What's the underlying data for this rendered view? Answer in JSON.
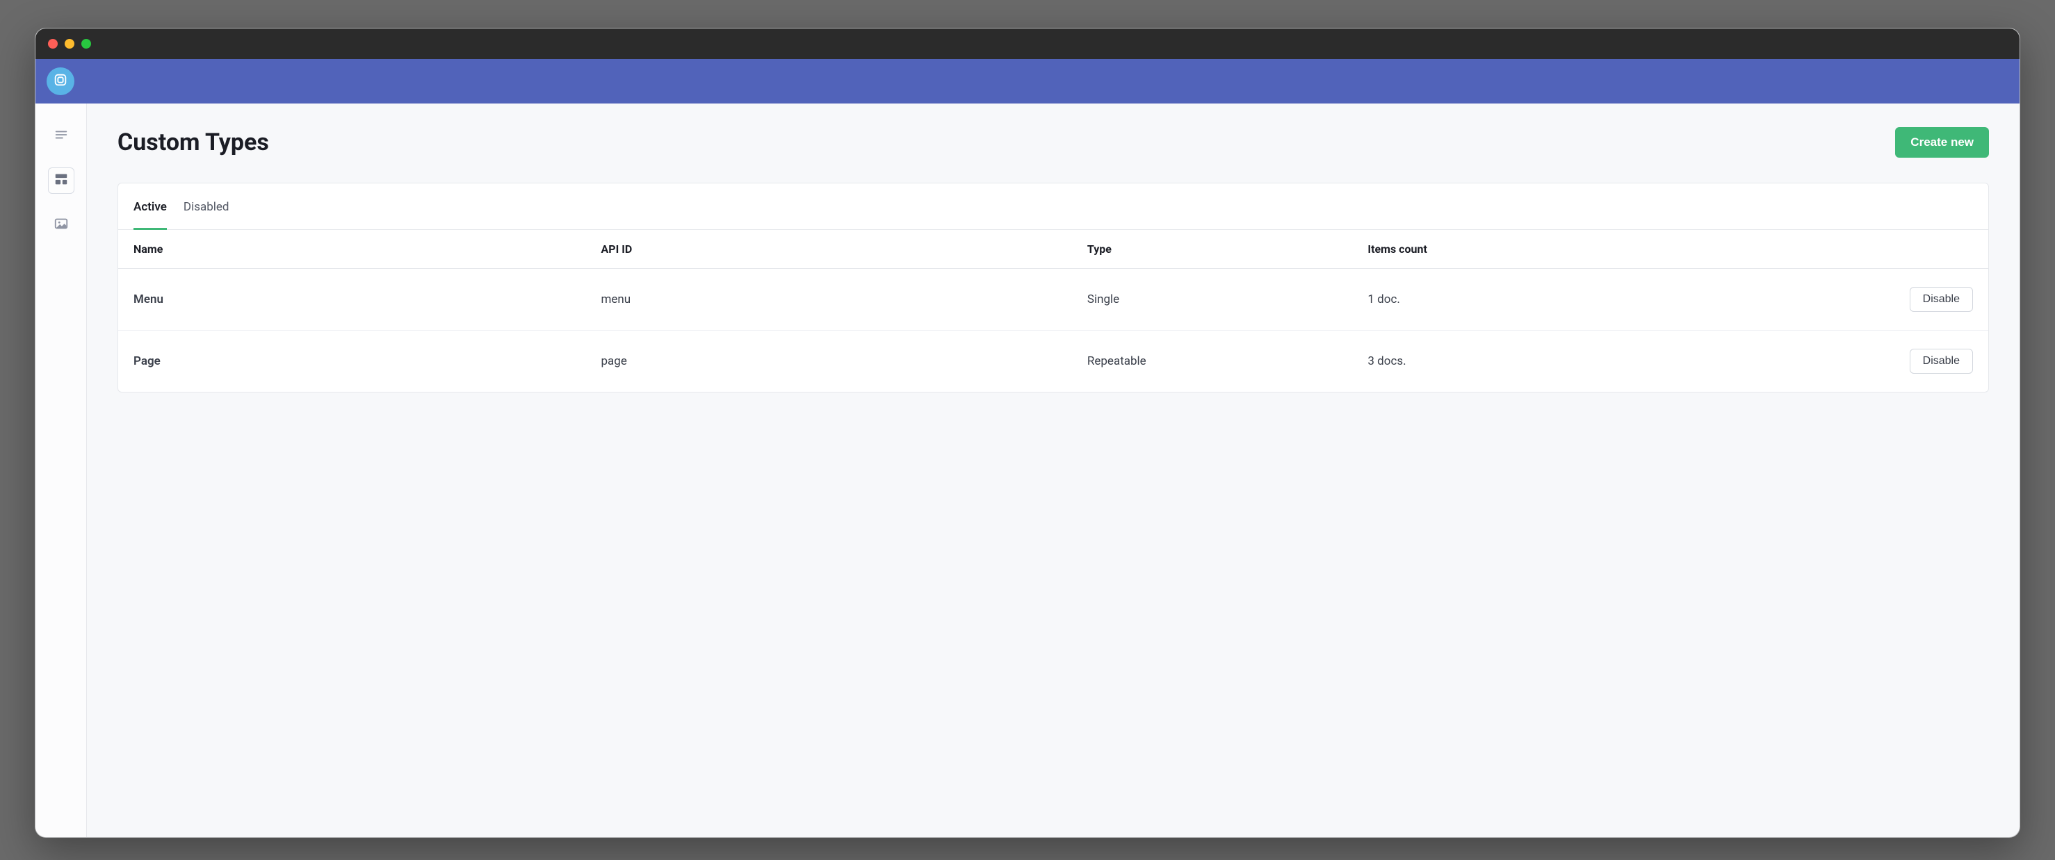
{
  "window": {
    "title": ""
  },
  "sidebar": {
    "items": [
      {
        "name": "documents-nav",
        "icon": "lines"
      },
      {
        "name": "custom-types-nav",
        "icon": "layout",
        "active": true
      },
      {
        "name": "media-nav",
        "icon": "image"
      }
    ]
  },
  "header": {
    "title": "Custom Types",
    "create_label": "Create new"
  },
  "tabs": [
    {
      "key": "active",
      "label": "Active",
      "active": true
    },
    {
      "key": "disabled",
      "label": "Disabled",
      "active": false
    }
  ],
  "table": {
    "columns": {
      "name": "Name",
      "api_id": "API ID",
      "type": "Type",
      "items_count": "Items count"
    },
    "rows": [
      {
        "name": "Menu",
        "api_id": "menu",
        "type": "Single",
        "items_count": "1 doc.",
        "action_label": "Disable"
      },
      {
        "name": "Page",
        "api_id": "page",
        "type": "Repeatable",
        "items_count": "3 docs.",
        "action_label": "Disable"
      }
    ]
  },
  "colors": {
    "accent_green": "#3fb877",
    "header_purple": "#5163ba",
    "logo_blue": "#59b3e6"
  }
}
